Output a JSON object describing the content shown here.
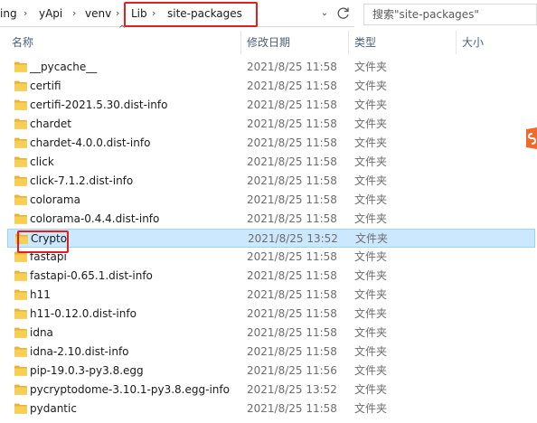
{
  "address": {
    "crumbs": [
      "ing",
      "yApi",
      "venv",
      "Lib",
      "site-packages"
    ]
  },
  "search": {
    "placeholder": "搜索\"site-packages\""
  },
  "columns": {
    "name": "名称",
    "date": "修改日期",
    "type": "类型",
    "size": "大小"
  },
  "rows": [
    {
      "name": "__pycache__",
      "date": "2021/8/25 11:58",
      "type": "文件夹"
    },
    {
      "name": "certifi",
      "date": "2021/8/25 11:58",
      "type": "文件夹"
    },
    {
      "name": "certifi-2021.5.30.dist-info",
      "date": "2021/8/25 11:58",
      "type": "文件夹"
    },
    {
      "name": "chardet",
      "date": "2021/8/25 11:58",
      "type": "文件夹"
    },
    {
      "name": "chardet-4.0.0.dist-info",
      "date": "2021/8/25 11:58",
      "type": "文件夹"
    },
    {
      "name": "click",
      "date": "2021/8/25 11:58",
      "type": "文件夹"
    },
    {
      "name": "click-7.1.2.dist-info",
      "date": "2021/8/25 11:58",
      "type": "文件夹"
    },
    {
      "name": "colorama",
      "date": "2021/8/25 11:58",
      "type": "文件夹"
    },
    {
      "name": "colorama-0.4.4.dist-info",
      "date": "2021/8/25 11:58",
      "type": "文件夹"
    },
    {
      "name": "Crypto",
      "date": "2021/8/25 13:52",
      "type": "文件夹",
      "selected": true
    },
    {
      "name": "fastapi",
      "date": "2021/8/25 11:58",
      "type": "文件夹"
    },
    {
      "name": "fastapi-0.65.1.dist-info",
      "date": "2021/8/25 11:58",
      "type": "文件夹"
    },
    {
      "name": "h11",
      "date": "2021/8/25 11:58",
      "type": "文件夹"
    },
    {
      "name": "h11-0.12.0.dist-info",
      "date": "2021/8/25 11:58",
      "type": "文件夹"
    },
    {
      "name": "idna",
      "date": "2021/8/25 11:58",
      "type": "文件夹"
    },
    {
      "name": "idna-2.10.dist-info",
      "date": "2021/8/25 11:58",
      "type": "文件夹"
    },
    {
      "name": "pip-19.0.3-py3.8.egg",
      "date": "2021/8/25 11:56",
      "type": "文件夹"
    },
    {
      "name": "pycryptodome-3.10.1-py3.8.egg-info",
      "date": "2021/8/25 13:52",
      "type": "文件夹"
    },
    {
      "name": "pydantic",
      "date": "2021/8/25 11:58",
      "type": "文件夹"
    }
  ],
  "icons": {
    "folder": "folder-icon",
    "refresh": "refresh-icon",
    "dropdown": "chevron-down-icon",
    "separator": "chevron-right-icon"
  },
  "colors": {
    "selection_bg": "#cce8ff",
    "selection_border": "#99d1ff",
    "highlight": "#e02020",
    "folder": "#f5c342"
  }
}
